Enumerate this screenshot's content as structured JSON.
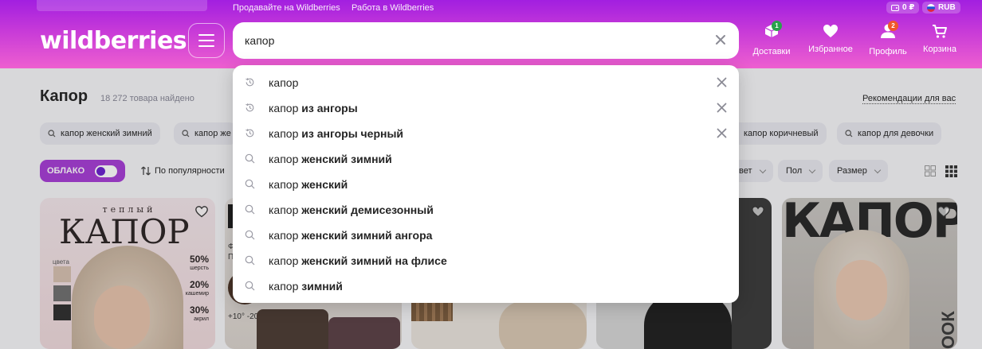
{
  "header": {
    "top_links": [
      "Продавайте на Wildberries",
      "Работа в Wildberries"
    ],
    "balance": "0 ₽",
    "currency": "RUB",
    "logo": "wildberries",
    "search_value": "капор",
    "nav": [
      {
        "label": "Доставки",
        "icon": "box-icon",
        "badge": "1",
        "badge_color": "#2aa24b"
      },
      {
        "label": "Избранное",
        "icon": "heart-icon",
        "badge": null,
        "badge_color": null
      },
      {
        "label": "Профиль",
        "icon": "user-icon",
        "badge": "2",
        "badge_color": "#f0562a"
      },
      {
        "label": "Корзина",
        "icon": "cart-icon",
        "badge": null,
        "badge_color": null
      }
    ]
  },
  "page": {
    "title": "Капор",
    "count": "18 272 товара найдено",
    "recommendations": "Рекомендации для вас",
    "chips": [
      "капор женский зимний",
      "капор же",
      "капор коричневый",
      "капор для девочки"
    ],
    "cloud_label": "ОБЛАКО",
    "sort_label": "По популярности",
    "filters": [
      "вет",
      "Пол",
      "Размер"
    ]
  },
  "card1": {
    "top_word": "теплый",
    "big_word": "КАПОР",
    "colors_label": "цвета",
    "compositions": [
      {
        "pct": "50%",
        "name": "шерсть"
      },
      {
        "pct": "20%",
        "name": "кашемир"
      },
      {
        "pct": "30%",
        "name": "акрил"
      }
    ]
  },
  "card2": {
    "temps": "+10°  -20°",
    "letters": "Ф\nП"
  },
  "card5": {
    "big_word": "КАПОР",
    "side_word": "ООК"
  },
  "suggestions": [
    {
      "type": "history",
      "base": "капор",
      "bold": ""
    },
    {
      "type": "history",
      "base": "капор ",
      "bold": "из ангоры"
    },
    {
      "type": "history",
      "base": "капор ",
      "bold": "из ангоры черный"
    },
    {
      "type": "search",
      "base": "капор ",
      "bold": "женский зимний"
    },
    {
      "type": "search",
      "base": "капор ",
      "bold": "женский"
    },
    {
      "type": "search",
      "base": "капор ",
      "bold": "женский демисезонный"
    },
    {
      "type": "search",
      "base": "капор ",
      "bold": "женский зимний ангора"
    },
    {
      "type": "search",
      "base": "капор ",
      "bold": "женский зимний на флисе"
    },
    {
      "type": "search",
      "base": "капор ",
      "bold": "зимний"
    }
  ],
  "colors": {
    "brand": "#a21fe0",
    "brand_pink": "#ee5fd0",
    "cloud": "#a63cd6"
  }
}
